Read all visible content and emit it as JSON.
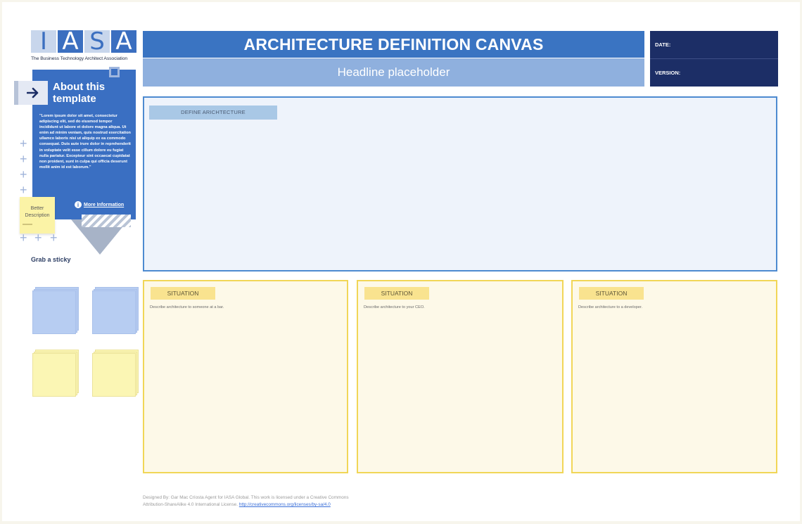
{
  "logo": {
    "letters": [
      "I",
      "A",
      "S",
      "A"
    ],
    "tagline": "The Business Technology Architect Association"
  },
  "about": {
    "title": "About this template",
    "text": "\"Lorem ipsum dolor sit amet, consectetur adipiscing elit, sed do eiusmod tempor incididunt ut labore et dolore magna aliqua. Ut enim ad minim veniam, quis nostrud exercitation ullamco laboris nisi ut aliquip ex ea commodo consequat. Duis aute irure dolor in reprehenderit in voluptate velit esse cillum dolore eu fugiat nulla pariatur. Excepteur sint occaecat cupidatat non proident, sunt in culpa qui officia deserunt mollit anim id est laborum.\"",
    "more_info": "More Information",
    "arrow_icon": "arrow-right-icon",
    "info_icon": "info-icon"
  },
  "sticky_note": {
    "text_line1": "Better",
    "text_line2": "Description"
  },
  "grab_sticky": "Grab a sticky",
  "header": {
    "title": "ARCHITECTURE DEFINITION CANVAS",
    "headline": "Headline placeholder",
    "date_label": "DATE:",
    "version_label": "VERSION:"
  },
  "define": {
    "tag": "DEFINE ARICHTECTURE"
  },
  "situations": [
    {
      "tag": "SITUATION",
      "desc": "Describe architecture to someone at a bar."
    },
    {
      "tag": "SITUATION",
      "desc": "Describe architecture to your CEO."
    },
    {
      "tag": "SITUATION",
      "desc": "Describe architecture to a developer."
    }
  ],
  "footer": {
    "line1": "Designed By: Gar Mac Críosta Agent for IASA Global. This work is licensed under a Creative Commons",
    "line2": "Attribution-ShareAlike 4.0 International License.",
    "link": "http://creativecommons.org/licenses/by-sa/4.0"
  },
  "colors": {
    "title_blue": "#3a74c2",
    "headline_blue": "#8fb0de",
    "navy": "#1c2e66",
    "situation_border": "#f1d657",
    "define_border": "#4d8ad0"
  }
}
